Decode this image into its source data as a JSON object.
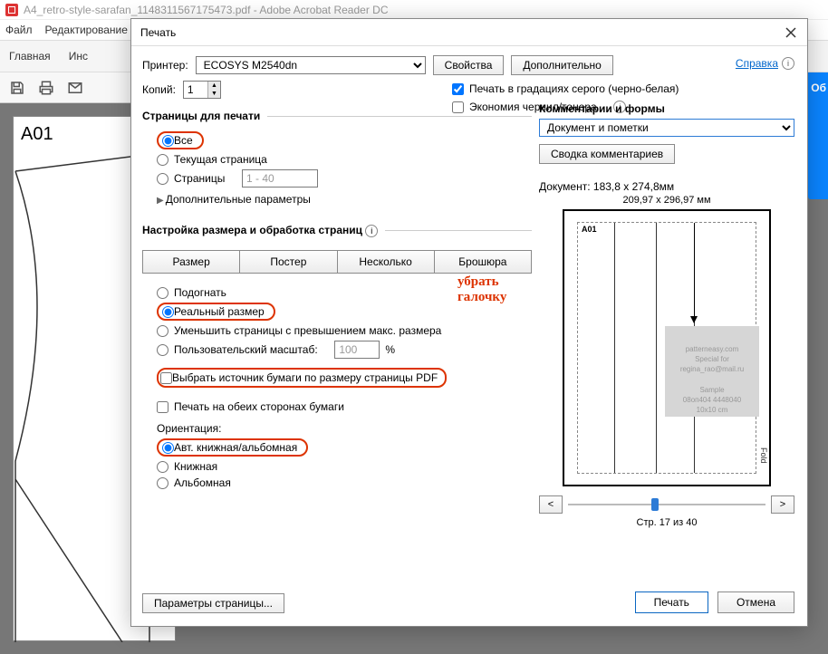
{
  "app": {
    "title": "A4_retro-style-sarafan_1148311567175473.pdf - Adobe Acrobat Reader DC",
    "menu": {
      "file": "Файл",
      "edit": "Редактирование"
    },
    "tabs": {
      "home": "Главная",
      "tools": "Инс"
    },
    "rightbtn": "Об"
  },
  "doc": {
    "pagelabel": "A01"
  },
  "dialog": {
    "title": "Печать",
    "printer_lbl": "Принтер:",
    "printer": "ECOSYS M2540dn",
    "properties": "Свойства",
    "advanced": "Дополнительно",
    "help": "Справка",
    "copies_lbl": "Копий:",
    "copies": "1",
    "grayscale": "Печать в градациях серого (черно-белая)",
    "savetoner": "Экономия чернил/тонера",
    "pages_legend": "Страницы для печати",
    "all": "Все",
    "current": "Текущая страница",
    "pages": "Страницы",
    "pages_range": "1 - 40",
    "moreopts": "Дополнительные параметры",
    "sizing_legend": "Настройка размера и обработка страниц",
    "seg": {
      "size": "Размер",
      "poster": "Постер",
      "multiple": "Несколько",
      "booklet": "Брошюра"
    },
    "fit": "Подогнать",
    "actual": "Реальный размер",
    "shrink": "Уменьшить страницы с превышением макс. размера",
    "custom": "Пользовательский масштаб:",
    "custom_val": "100",
    "pct": "%",
    "paper_source": "Выбрать источник бумаги по размеру страницы PDF",
    "duplex": "Печать на обеих сторонах бумаги",
    "orient_lbl": "Ориентация:",
    "o_auto": "Авт. книжная/альбомная",
    "o_port": "Книжная",
    "o_land": "Альбомная",
    "comments_legend": "Комментарии и формы",
    "comments_sel": "Документ и пометки",
    "summarize": "Сводка комментариев",
    "docsize": "Документ: 183,8 x 274,8мм",
    "papersize": "209,97 x 296,97 мм",
    "pv_label": "A01",
    "pv_fold": "Fold",
    "page_of": "Стр. 17 из 40",
    "page_setup": "Параметры страницы...",
    "print": "Печать",
    "cancel": "Отмена",
    "prev": "<",
    "next": ">",
    "annotation": "убрать галочку"
  }
}
